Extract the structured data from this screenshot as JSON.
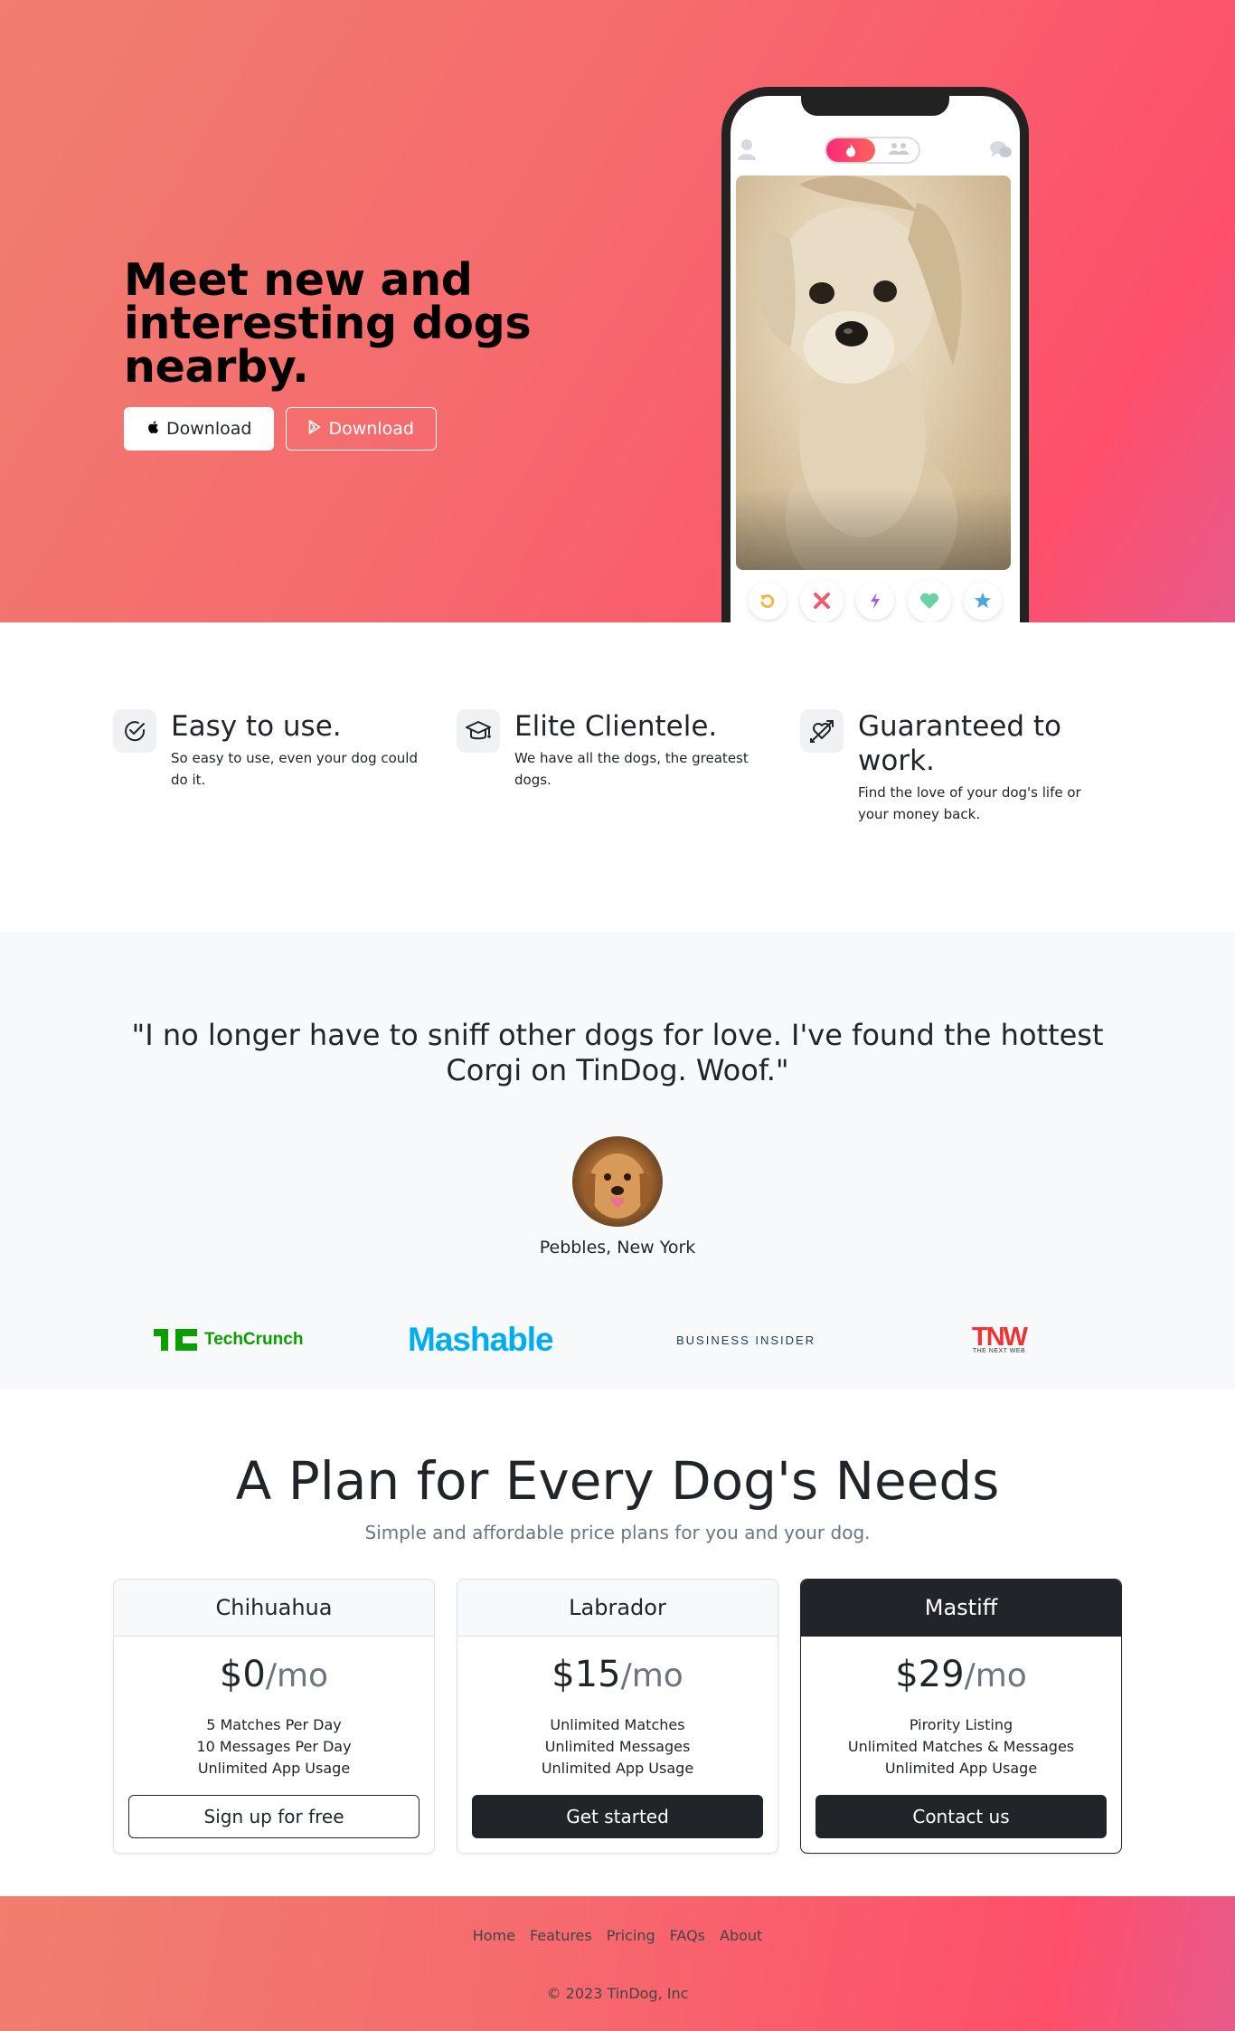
{
  "hero": {
    "title": "Meet new and interesting dogs nearby.",
    "buttons": [
      {
        "label": "Download",
        "icon": "apple-icon"
      },
      {
        "label": "Download",
        "icon": "google-play-icon"
      }
    ]
  },
  "features": [
    {
      "title": "Easy to use.",
      "description": "So easy to use, even your dog could do it.",
      "icon": "check-circle-icon"
    },
    {
      "title": "Elite Clientele.",
      "description": "We have all the dogs, the greatest dogs.",
      "icon": "graduation-cap-icon"
    },
    {
      "title": "Guaranteed to work.",
      "description": "Find the love of your dog's life or your money back.",
      "icon": "heart-arrow-icon"
    }
  ],
  "testimonial": {
    "quote": "\"I no longer have to sniff other dogs for love. I've found the hottest Corgi on TinDog. Woof.\"",
    "author": "Pebbles, New York"
  },
  "press": {
    "techcrunch": "TechCrunch",
    "mashable": "Mashable",
    "business_insider": "BUSINESS INSIDER",
    "tnw": "TNW",
    "tnw_sub": "THE NEXT WEB"
  },
  "pricing": {
    "title": "A Plan for Every Dog's Needs",
    "subtitle": "Simple and affordable price plans for you and your dog.",
    "plans": [
      {
        "name": "Chihuahua",
        "price": "$0",
        "period": "/mo",
        "features": [
          "5 Matches Per Day",
          "10 Messages Per Day",
          "Unlimited App Usage"
        ],
        "button": "Sign up for free"
      },
      {
        "name": "Labrador",
        "price": "$15",
        "period": "/mo",
        "features": [
          "Unlimited Matches",
          "Unlimited Messages",
          "Unlimited App Usage"
        ],
        "button": "Get started"
      },
      {
        "name": "Mastiff",
        "price": "$29",
        "period": "/mo",
        "features": [
          "Pirority Listing",
          "Unlimited Matches & Messages",
          "Unlimited App Usage"
        ],
        "button": "Contact us"
      }
    ]
  },
  "footer": {
    "nav": [
      "Home",
      "Features",
      "Pricing",
      "FAQs",
      "About"
    ],
    "copyright": "© 2023 TinDog, Inc"
  },
  "colors": {
    "brand_coral": "#f66a6e",
    "brand_pink": "#fd4f6a",
    "dark": "#212529"
  }
}
